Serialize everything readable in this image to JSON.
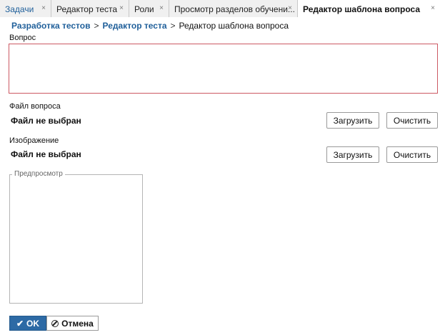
{
  "tabs": [
    {
      "label": "Задачи",
      "close": "×"
    },
    {
      "label": "Редактор теста",
      "close": "×"
    },
    {
      "label": "Роли",
      "close": "×"
    },
    {
      "label": "Просмотр разделов обучени...",
      "close": "×"
    },
    {
      "label": "Редактор шаблона вопроса",
      "close": "×"
    }
  ],
  "breadcrumb": {
    "item1": "Разработка тестов",
    "item2": "Редактор теста",
    "current": "Редактор шаблона вопроса",
    "separator": ">"
  },
  "question": {
    "label": "Вопрос",
    "value": ""
  },
  "question_file": {
    "label": "Файл вопроса",
    "status": "Файл не выбран",
    "upload_label": "Загрузить",
    "clear_label": "Очистить"
  },
  "image_file": {
    "label": "Изображение",
    "status": "Файл не выбран",
    "upload_label": "Загрузить",
    "clear_label": "Очистить"
  },
  "preview": {
    "legend": "Предпросмотр"
  },
  "actions": {
    "ok_label": "OK",
    "cancel_label": "Отмена"
  },
  "colors": {
    "primary": "#2d6aa5",
    "link": "#1f5f9a",
    "invalid_border": "#cd5963"
  },
  "icons": {
    "ok": "check-icon",
    "cancel": "cancel-circle-icon",
    "tab_close": "close-icon"
  }
}
